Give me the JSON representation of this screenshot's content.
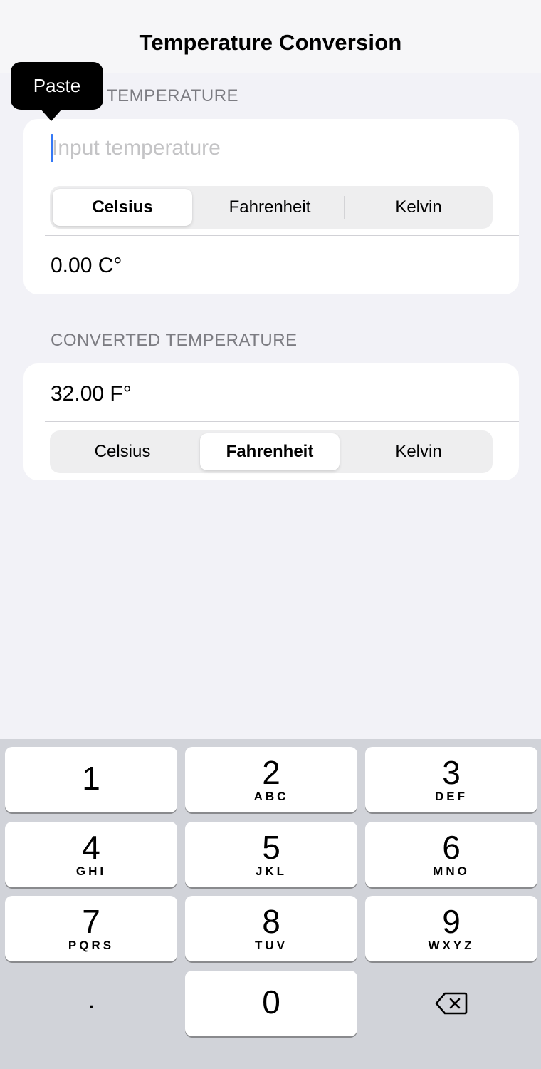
{
  "nav": {
    "title": "Temperature Conversion"
  },
  "input_section": {
    "header": "TEMPERATURE",
    "placeholder": "Input temperature",
    "value": "",
    "units": [
      "Celsius",
      "Fahrenheit",
      "Kelvin"
    ],
    "selected_unit": "Celsius",
    "result": "0.00 C°"
  },
  "tooltip": {
    "label": "Paste"
  },
  "output_section": {
    "header": "CONVERTED TEMPERATURE",
    "result": "32.00 F°",
    "units": [
      "Celsius",
      "Fahrenheit",
      "Kelvin"
    ],
    "selected_unit": "Fahrenheit"
  },
  "keyboard": {
    "keys": [
      {
        "digit": "1",
        "letters": ""
      },
      {
        "digit": "2",
        "letters": "ABC"
      },
      {
        "digit": "3",
        "letters": "DEF"
      },
      {
        "digit": "4",
        "letters": "GHI"
      },
      {
        "digit": "5",
        "letters": "JKL"
      },
      {
        "digit": "6",
        "letters": "MNO"
      },
      {
        "digit": "7",
        "letters": "PQRS"
      },
      {
        "digit": "8",
        "letters": "TUV"
      },
      {
        "digit": "9",
        "letters": "WXYZ"
      },
      {
        "digit": "0",
        "letters": ""
      }
    ],
    "decimal": ".",
    "delete_icon": "delete-backspace-icon"
  },
  "colors": {
    "background": "#f2f2f7",
    "caret": "#3478f6",
    "keyboard_bg": "#d1d3d9"
  }
}
